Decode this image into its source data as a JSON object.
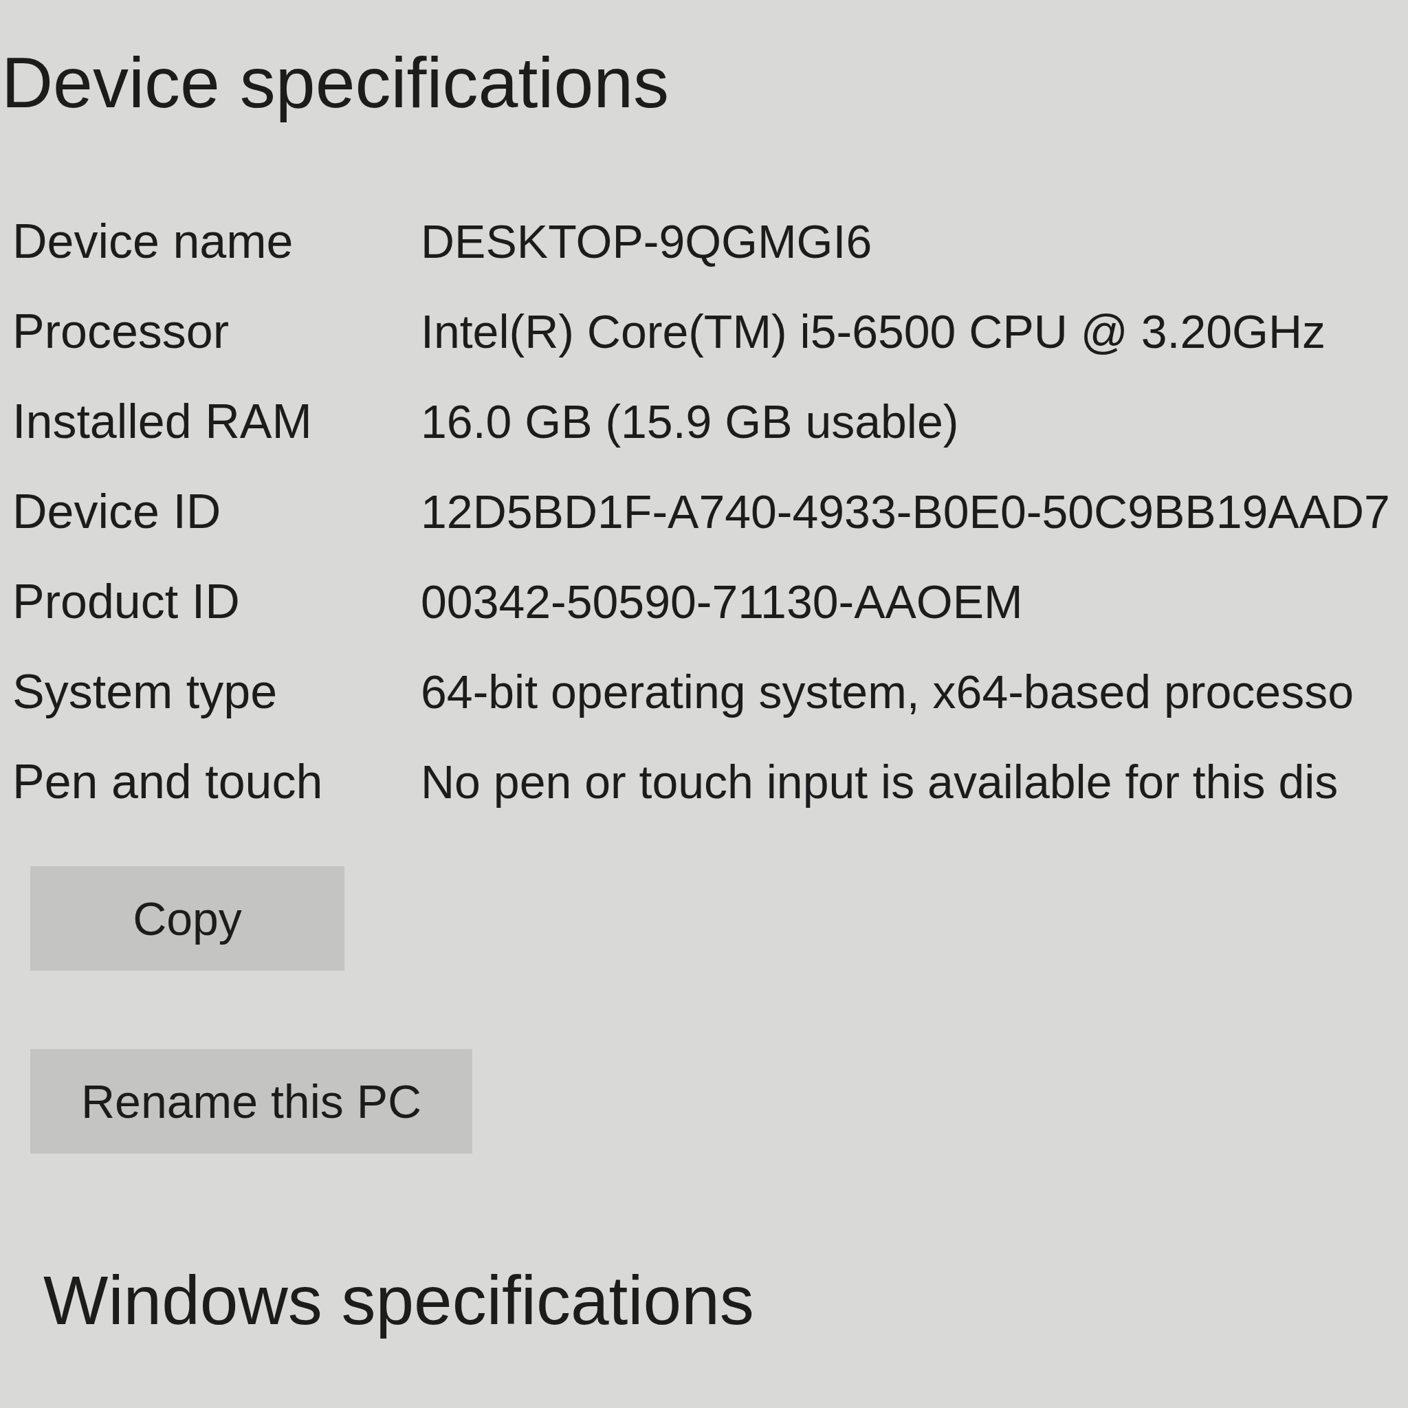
{
  "title": "Device specifications",
  "specs": [
    {
      "label": "Device name",
      "value": "DESKTOP-9QGMGI6"
    },
    {
      "label": "Processor",
      "value": "Intel(R) Core(TM) i5-6500 CPU @ 3.20GHz"
    },
    {
      "label": "Installed RAM",
      "value": "16.0 GB (15.9 GB usable)"
    },
    {
      "label": "Device ID",
      "value": "12D5BD1F-A740-4933-B0E0-50C9BB19AAD7"
    },
    {
      "label": "Product ID",
      "value": "00342-50590-71130-AAOEM"
    },
    {
      "label": "System type",
      "value": "64-bit operating system, x64-based processo"
    },
    {
      "label": "Pen and touch",
      "value": "No pen or touch input is available for this dis"
    }
  ],
  "buttons": [
    {
      "label": "Copy"
    },
    {
      "label": "Rename this PC"
    }
  ],
  "section_heading": "Windows specifications"
}
